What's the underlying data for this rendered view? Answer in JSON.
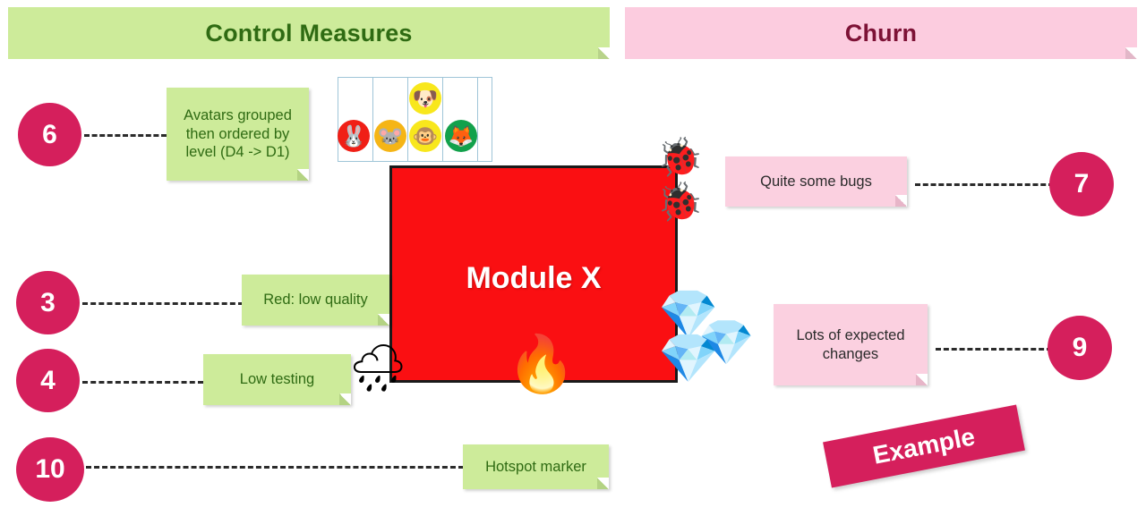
{
  "headers": {
    "left": {
      "label": "Control Measures",
      "bg": "#cdeb9a",
      "fg": "#2f6b13"
    },
    "right": {
      "label": "Churn",
      "bg": "#fcccdf",
      "fg": "#7d1236"
    }
  },
  "accent": {
    "bullet": "#d51f5c",
    "module": "#fa0f12",
    "note_green": "#cdeb9a",
    "note_pink": "#fbd0e0"
  },
  "module": {
    "label": "Module X"
  },
  "stamp": {
    "label": "Example"
  },
  "bullets": [
    {
      "number": "6"
    },
    {
      "number": "3"
    },
    {
      "number": "4"
    },
    {
      "number": "10"
    },
    {
      "number": "7"
    },
    {
      "number": "9"
    }
  ],
  "notes": {
    "avatars_grouped": "Avatars grouped then ordered by level (D4 -> D1)",
    "red_low_quality": "Red: low quality",
    "low_testing": "Low testing",
    "hotspot_marker": "Hotspot marker",
    "quite_some_bugs": "Quite some bugs",
    "lots_of_changes": "Lots of expected changes"
  },
  "avatars": [
    {
      "glyph": "🐰",
      "bg": "#f01f16",
      "name": "rabbit-avatar"
    },
    {
      "glyph": "🐭",
      "bg": "#f5b516",
      "name": "mouse-avatar"
    },
    {
      "glyph": "🐶",
      "bg": "#f8e71c",
      "name": "dog-avatar"
    },
    {
      "glyph": "🐵",
      "bg": "#f8e71c",
      "name": "monkey-avatar"
    },
    {
      "glyph": "🦊",
      "bg": "#12a14b",
      "name": "fox-avatar"
    }
  ],
  "decorations": {
    "bug_1": "🐞",
    "bug_2": "🐞",
    "gem_1": "💎",
    "gem_2": "💎",
    "gem_3": "💎",
    "rain_cloud": "🌧",
    "fire": "🔥"
  }
}
